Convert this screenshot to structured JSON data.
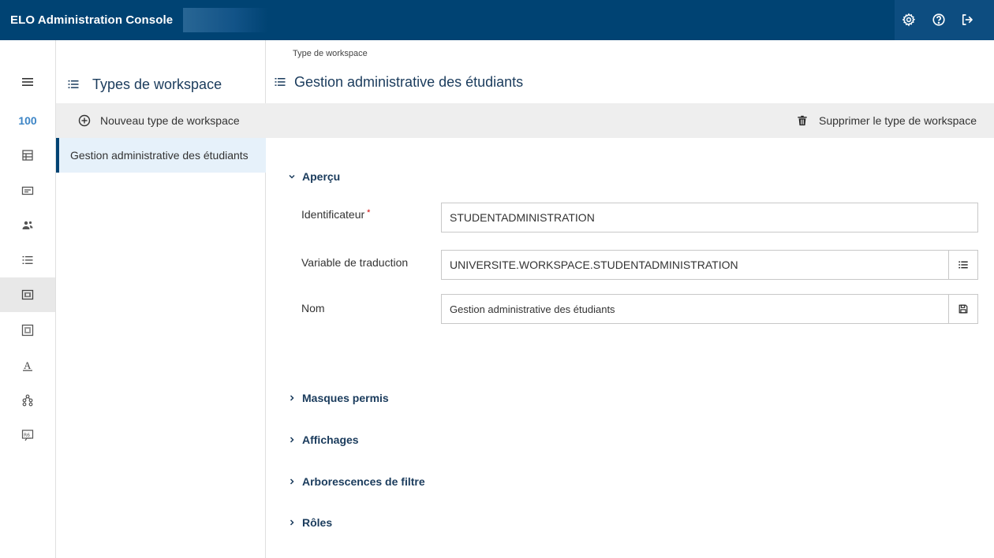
{
  "app": {
    "title": "ELO Administration Console"
  },
  "topbar_icons": [
    "gear-icon",
    "help-icon",
    "logout-icon"
  ],
  "rail": {
    "badge": "100",
    "items": [
      "menu-icon",
      "table-icon",
      "card-icon",
      "users-icon",
      "list-icon",
      "workspace-icon",
      "form-icon",
      "font-icon",
      "network-icon",
      "translate-icon"
    ],
    "active_index": 5
  },
  "list_panel": {
    "title": "Types de workspace",
    "new_button": "Nouveau type de workspace",
    "items": [
      {
        "label": "Gestion administrative des étudiants",
        "selected": true
      }
    ]
  },
  "main": {
    "breadcrumb": "Type de workspace",
    "title": "Gestion administrative des étudiants",
    "delete_button": "Supprimer le type de workspace",
    "sections": {
      "overview": "Aperçu",
      "allowed_masks": "Masques permis",
      "views": "Affichages",
      "filter_trees": "Arborescences de filtre",
      "roles": "Rôles"
    },
    "fields": {
      "identifier": {
        "label": "Identificateur",
        "required_mark": "*",
        "value": "STUDENTADMINISTRATION"
      },
      "translation_variable": {
        "label": "Variable de traduction",
        "value": "UNIVERSITE.WORKSPACE.STUDENTADMINISTRATION"
      },
      "name": {
        "label": "Nom",
        "value": "Gestion administrative des étudiants"
      }
    }
  },
  "colors": {
    "topbar": "#004373",
    "accent": "#3d85c6",
    "selected_bg": "#e6f1fa",
    "toolbar_bg": "#eeeeee"
  }
}
